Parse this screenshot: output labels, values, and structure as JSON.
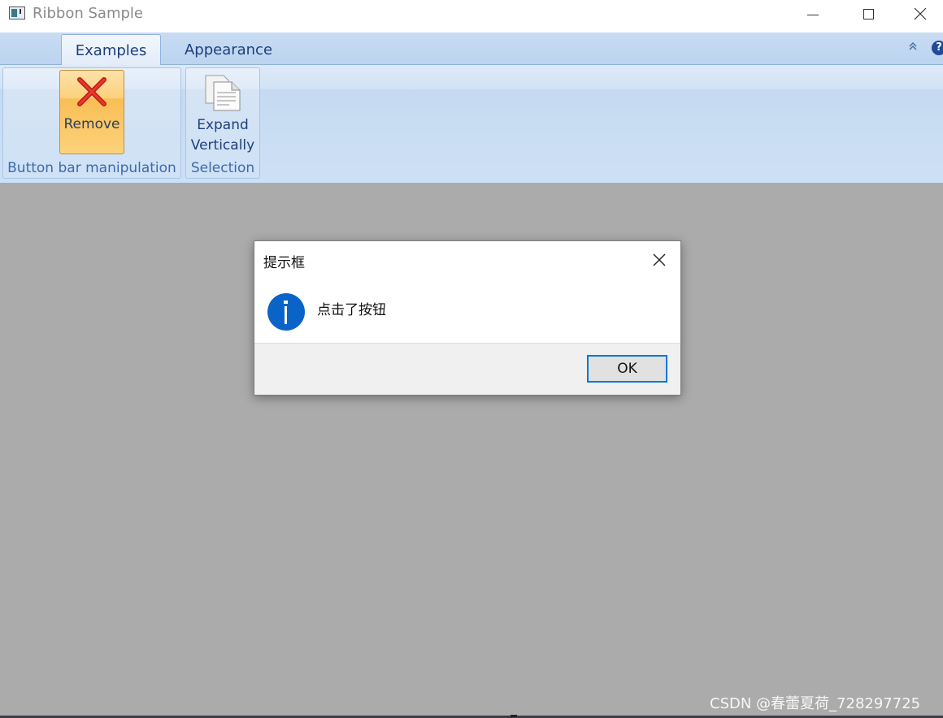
{
  "window": {
    "title": "Ribbon Sample"
  },
  "ribbon": {
    "tabs": [
      {
        "label": "Examples",
        "selected": true
      },
      {
        "label": "Appearance",
        "selected": false
      }
    ],
    "groups": [
      {
        "label": "Button bar manipulation",
        "buttons": [
          {
            "label": "Remove",
            "icon": "red-x-icon",
            "highlighted": true
          }
        ]
      },
      {
        "label": "Selection",
        "buttons": [
          {
            "label_line1": "Expand",
            "label_line2": "Vertically",
            "icon": "documents-icon"
          }
        ]
      }
    ],
    "help_label": "?"
  },
  "dialog": {
    "title": "提示框",
    "message": "点击了按钮",
    "ok_label": "OK",
    "icon": "info-icon"
  },
  "watermark": "CSDN @春蕾夏荷_728297725",
  "colors": {
    "ribbon_blue": "#bcd4f0",
    "highlight_orange": "#f9be55",
    "info_blue": "#0a64c8",
    "focus_blue": "#0078d7",
    "background_gray": "#ababab"
  }
}
